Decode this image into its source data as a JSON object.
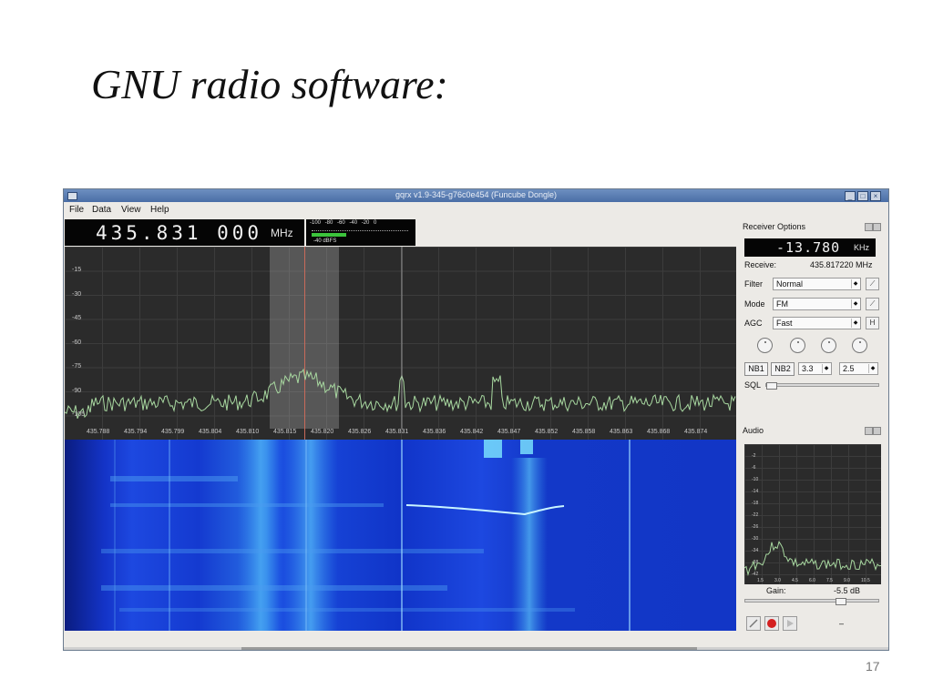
{
  "slide": {
    "title": "GNU radio software:",
    "page_number": "17"
  },
  "window": {
    "title": "gqrx v1.9-345-g76c0e454 (Funcube Dongle)",
    "menu": [
      "File",
      "Data",
      "View",
      "Help"
    ]
  },
  "frequency": {
    "value": "435.831 000",
    "unit": "MHz"
  },
  "signal_meter": {
    "scale": [
      "-100",
      "-80",
      "-60",
      "-40",
      "-20",
      "0"
    ],
    "level_label": "-40 dBFS",
    "level_fraction": 0.36
  },
  "fft": {
    "y_ticks": [
      "-15",
      "-30",
      "-45",
      "-60",
      "-75",
      "-90",
      "-105"
    ],
    "x_ticks": [
      "435.788",
      "435.794",
      "435.799",
      "435.804",
      "435.810",
      "435.815",
      "435.820",
      "435.826",
      "435.831",
      "435.836",
      "435.842",
      "435.847",
      "435.852",
      "435.858",
      "435.863",
      "435.868",
      "435.874"
    ]
  },
  "receiver_options": {
    "title": "Receiver Options",
    "offset_value": "-13.780",
    "offset_unit": "KHz",
    "receive_label": "Receive:",
    "receive_value": "435.817220 MHz",
    "filter_label": "Filter",
    "filter_value": "Normal",
    "mode_label": "Mode",
    "mode_value": "FM",
    "agc_label": "AGC",
    "agc_value": "Fast",
    "agc_button": "H",
    "nb1": "NB1",
    "nb2": "NB2",
    "nb1_threshold": "3.3",
    "nb2_threshold": "2.5",
    "sql_label": "SQL"
  },
  "audio": {
    "title": "Audio",
    "y_ticks": [
      "-2",
      "-6",
      "-10",
      "-14",
      "-18",
      "-22",
      "-26",
      "-30",
      "-34",
      "-38",
      "-42"
    ],
    "x_ticks": [
      "1.5",
      "3.0",
      "4.5",
      "6.0",
      "7.5",
      "9.0",
      "10.5"
    ],
    "gain_label": "Gain:",
    "gain_value": "-5.5 dB",
    "gain_fraction": 0.72
  },
  "colors": {
    "waterfall_bg": "#1338c8",
    "fft_trace": "#a8d8a0",
    "record_button": "#d42020"
  }
}
